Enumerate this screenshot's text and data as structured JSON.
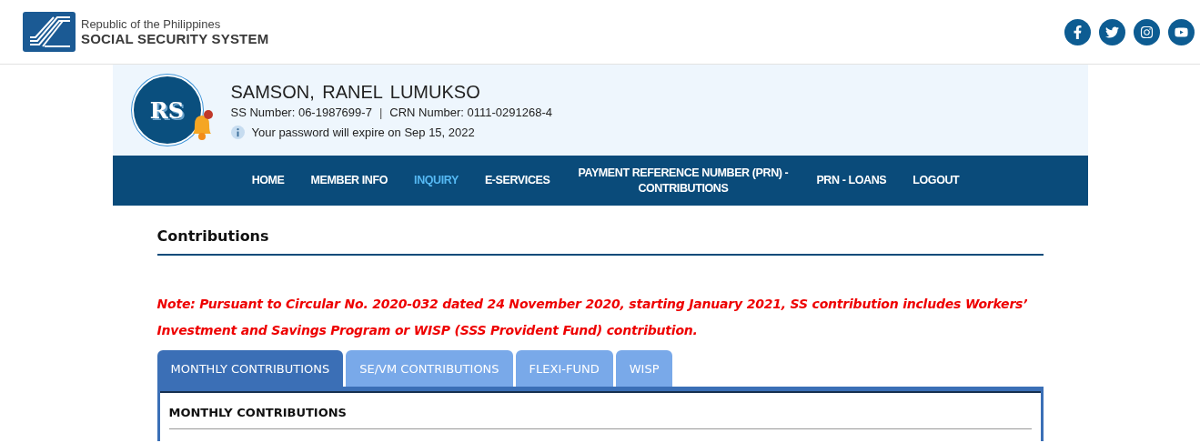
{
  "header": {
    "logo_line1": "Republic of the Philippines",
    "logo_line2": "SOCIAL SECURITY SYSTEM",
    "social": [
      {
        "kind": "facebook"
      },
      {
        "kind": "twitter"
      },
      {
        "kind": "instagram"
      },
      {
        "kind": "youtube"
      }
    ]
  },
  "profile": {
    "initials": "RS",
    "notification": true,
    "name": "SAMSON, RANEL LUMUKSO",
    "ss_number": "SS Number: 06-1987699-7",
    "separator": "|",
    "crn_number": "CRN Number: 0111-0291268-4",
    "password_notice": "Your password will expire on Sep 15, 2022"
  },
  "nav": [
    {
      "label": "HOME",
      "selected": false
    },
    {
      "label": "MEMBER INFO",
      "selected": false
    },
    {
      "label": "INQUIRY",
      "selected": true
    },
    {
      "label": "E-SERVICES",
      "selected": false
    },
    {
      "label": "PAYMENT REFERENCE NUMBER (PRN) - CONTRIBUTIONS",
      "selected": false
    },
    {
      "label": "PRN - LOANS",
      "selected": false
    },
    {
      "label": "LOGOUT",
      "selected": false
    }
  ],
  "page_title": "Contributions",
  "note": "Note: Pursuant to Circular No. 2020-032 dated 24 November 2020, starting January 2021, SS contribution includes Workers’ Investment and Savings Program or WISP (SSS Provident Fund) contribution.",
  "tabs": [
    {
      "label": "MONTHLY CONTRIBUTIONS",
      "selected": true
    },
    {
      "label": "SE/VM CONTRIBUTIONS",
      "selected": false
    },
    {
      "label": "FLEXI-FUND",
      "selected": false
    },
    {
      "label": "WISP",
      "selected": false
    }
  ],
  "panel": {
    "title": "MONTHLY CONTRIBUTIONS"
  }
}
